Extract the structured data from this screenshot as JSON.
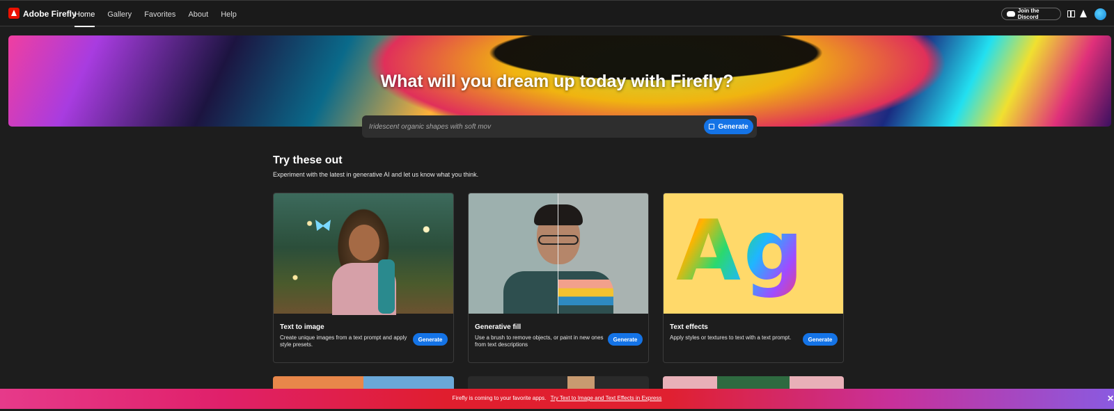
{
  "header": {
    "brand": "Adobe Firefly",
    "nav": [
      "Home",
      "Gallery",
      "Favorites",
      "About",
      "Help"
    ],
    "active_nav": "Home",
    "discord_label": "Join the Discord"
  },
  "hero": {
    "title": "What will you dream up today with Firefly?",
    "prompt_value": "Iridescent organic shapes with soft mov",
    "generate_label": "Generate"
  },
  "section": {
    "title": "Try these out",
    "subtitle": "Experiment with the latest in generative AI and let us know what you think."
  },
  "cards": [
    {
      "title": "Text to image",
      "description": "Create unique images from a text prompt and apply style presets.",
      "button": "Generate"
    },
    {
      "title": "Generative fill",
      "description": "Use a brush to remove objects, or paint in new ones from text descriptions",
      "button": "Generate"
    },
    {
      "title": "Text effects",
      "description": "Apply styles or textures to text with a text prompt.",
      "button": "Generate",
      "image_text": "Ag"
    }
  ],
  "promo": {
    "text": "Firefly is coming to your favorite apps.",
    "link": "Try Text to Image and Text Effects in Express"
  },
  "colors": {
    "accent": "#1473e6",
    "background": "#1d1d1d",
    "brand_red": "#eb1000"
  }
}
